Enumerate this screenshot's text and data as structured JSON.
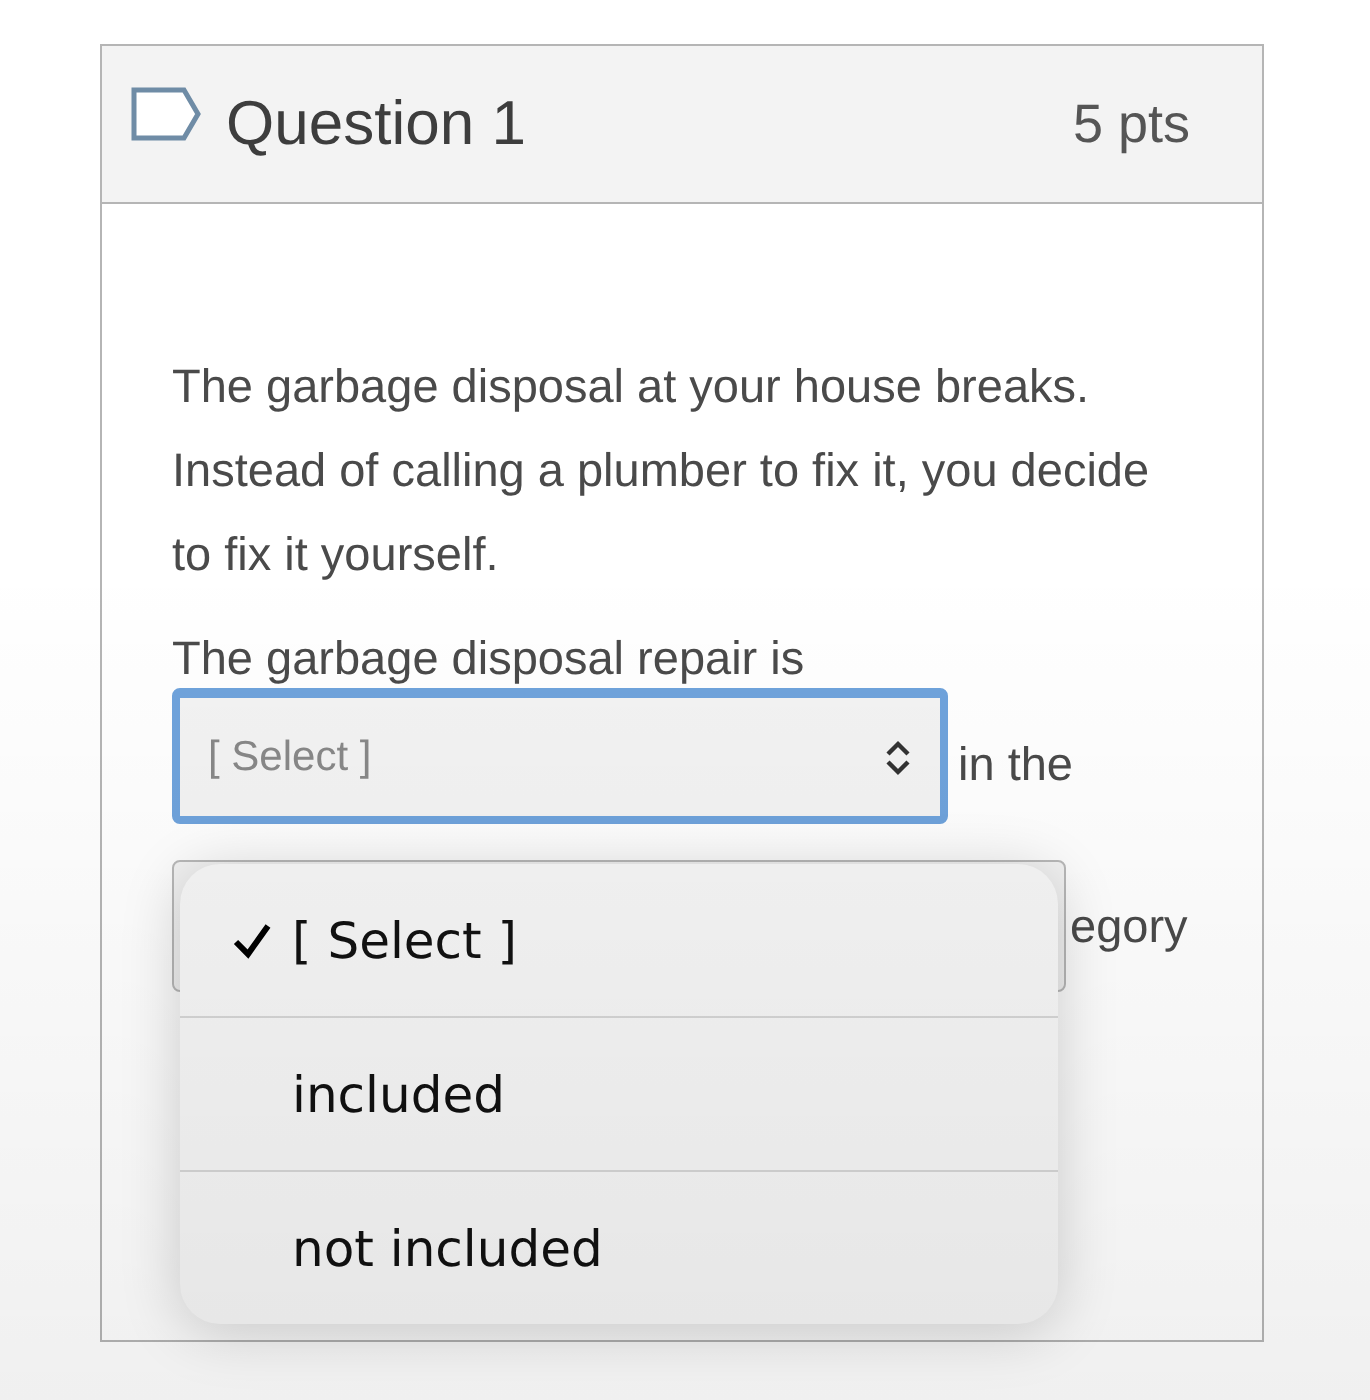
{
  "question": {
    "title": "Question 1",
    "points": "5 pts",
    "paragraph": "The garbage disposal at your house breaks. Instead of calling a plumber to fix it, you decide to fix it yourself.",
    "statement": "The garbage disposal repair is",
    "select": {
      "value": "[ Select ]",
      "focused": true
    },
    "after_select": "in the",
    "second_select_tail": "egory"
  },
  "dropdown": {
    "options": [
      {
        "label": "[ Select ]",
        "selected": true
      },
      {
        "label": "included",
        "selected": false
      },
      {
        "label": "not included",
        "selected": false
      }
    ]
  }
}
